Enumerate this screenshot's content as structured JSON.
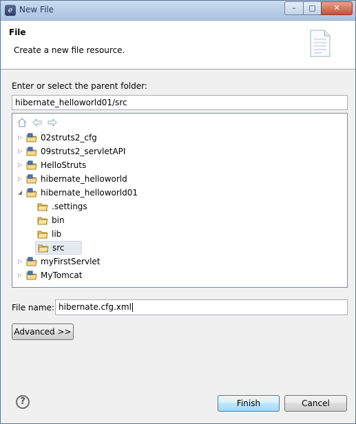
{
  "window": {
    "title": "New File",
    "min_glyph": "–",
    "max_glyph": "□",
    "close_glyph": "✕"
  },
  "header": {
    "title": "File",
    "description": "Create a new file resource."
  },
  "parent_folder": {
    "label": "Enter or select the parent folder:",
    "value": "hibernate_helloworld01/src"
  },
  "tree": {
    "toolbar": [
      "home-icon",
      "back-icon",
      "forward-icon"
    ],
    "items": [
      {
        "label": "02struts2_cfg",
        "type": "project",
        "expanded": false
      },
      {
        "label": "09struts2_servletAPI",
        "type": "project",
        "expanded": false
      },
      {
        "label": "HelloStruts",
        "type": "project",
        "expanded": false
      },
      {
        "label": "hibernate_helloworld",
        "type": "project",
        "expanded": false
      },
      {
        "label": "hibernate_helloworld01",
        "type": "project",
        "expanded": true
      },
      {
        "label": ".settings",
        "type": "folder"
      },
      {
        "label": "bin",
        "type": "folder"
      },
      {
        "label": "lib",
        "type": "folder"
      },
      {
        "label": "src",
        "type": "folder",
        "selected": true
      },
      {
        "label": "myFirstServlet",
        "type": "project",
        "expanded": false
      },
      {
        "label": "MyTomcat",
        "type": "project",
        "expanded": false
      }
    ]
  },
  "file_name": {
    "label": "File name:",
    "value": "hibernate.cfg.xml"
  },
  "buttons": {
    "advanced": "Advanced >>",
    "finish": "Finish",
    "cancel": "Cancel",
    "help": "?"
  }
}
